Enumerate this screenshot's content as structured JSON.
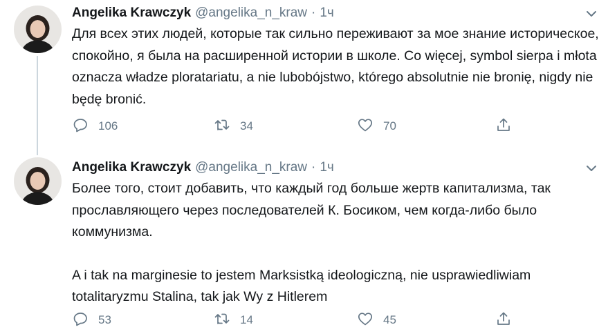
{
  "tweets": [
    {
      "author_name": "Angelika Krawczyk",
      "handle": "@angelika_n_kraw",
      "separator": "·",
      "time": "1ч",
      "paragraphs": [
        "Для всех этих людей, которые так сильно переживают за мое знание историческое, спокойно, я была на расширенной истории в школе. Co więcej, symbol sierpa i młota oznacza władze ploratariatu, a nie lubobójstwo, którego absolutnie nie bronię, nigdy nie będę bronić."
      ],
      "replies": "106",
      "retweets": "34",
      "likes": "70"
    },
    {
      "author_name": "Angelika Krawczyk",
      "handle": "@angelika_n_kraw",
      "separator": "·",
      "time": "1ч",
      "paragraphs": [
        "Более того, стоит добавить, что каждый год больше жертв капитализма, так прославляющего через последователей К. Босиком, чем когда-либо было коммунизма.",
        "A i tak na marginesie to jestem Marksistką ideologiczną, nie usprawiedliwiam totalitaryzmu Stalina, tak jak Wy z Hitlerem"
      ],
      "replies": "53",
      "retweets": "14",
      "likes": "45"
    }
  ],
  "colors": {
    "text": "#14171a",
    "secondary": "#657786",
    "thread_line": "#ccd6dd"
  },
  "icons": {
    "reply": "speech-bubble-icon",
    "retweet": "retweet-arrows-icon",
    "like": "heart-icon",
    "share": "share-upload-icon",
    "menu": "chevron-down-icon"
  }
}
